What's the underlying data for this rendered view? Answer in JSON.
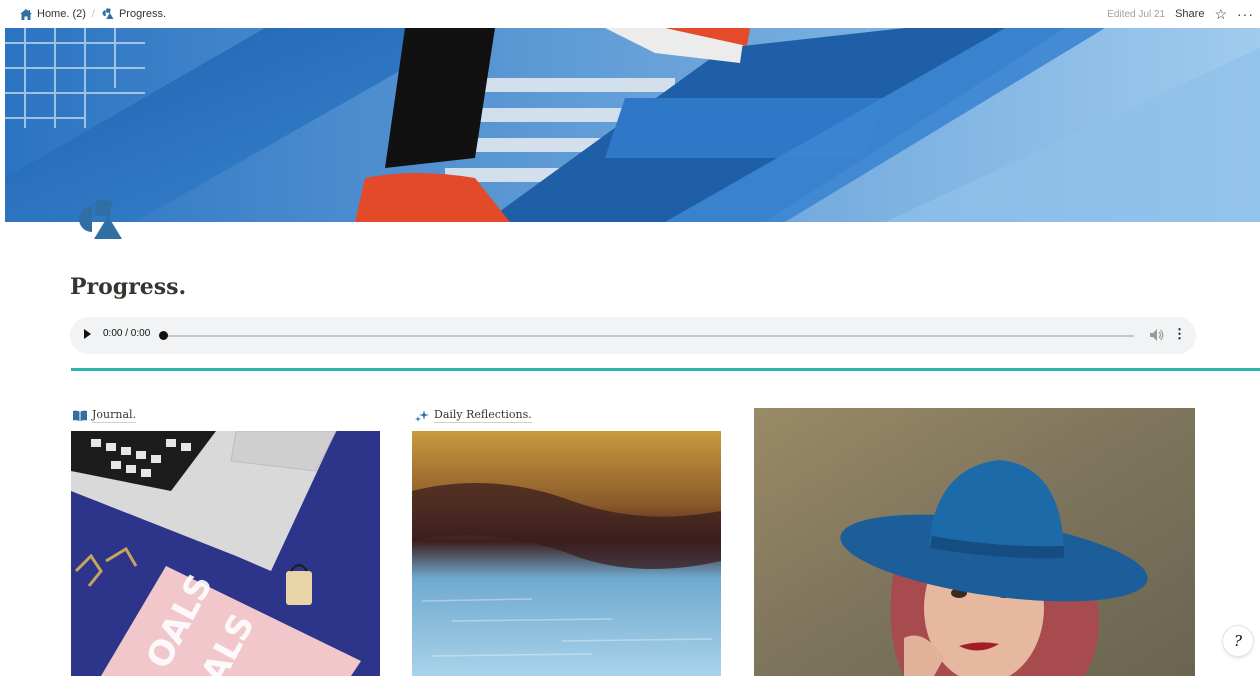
{
  "topbar": {
    "breadcrumbs": [
      {
        "label": "Home. (2)",
        "icon": "house-icon"
      },
      {
        "label": "Progress.",
        "icon": "shapes-icon"
      }
    ],
    "edited": "Edited Jul 21",
    "share_label": "Share",
    "favorite_icon": "star-icon",
    "more_icon": "more-icon"
  },
  "page": {
    "title": "Progress.",
    "icon": "shapes-icon",
    "icon_color": "#2f6fa3"
  },
  "audio": {
    "time": "0:00 / 0:00",
    "progress": 0
  },
  "divider_color": "#2fb3ad",
  "links": [
    {
      "label": "Journal.",
      "icon": "open-book-icon"
    },
    {
      "label": "Daily Reflections.",
      "icon": "sparkles-icon"
    }
  ],
  "help": {
    "label": "?"
  }
}
